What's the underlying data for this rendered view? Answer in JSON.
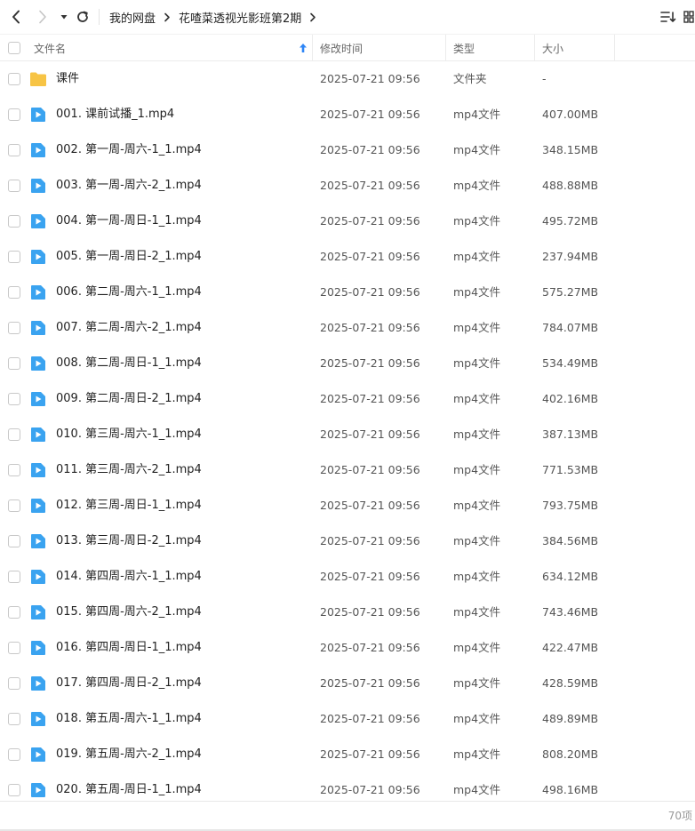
{
  "toolbar": {
    "breadcrumbs": [
      "我的网盘",
      "花喳菜透视光影班第2期"
    ],
    "icons": {
      "back": "back-arrow-icon",
      "forward": "forward-arrow-icon",
      "history": "history-dropdown-icon",
      "refresh": "refresh-icon",
      "sort": "sort-icon",
      "view": "view-toggle-icon"
    }
  },
  "header": {
    "name": "文件名",
    "mtime": "修改时间",
    "type": "类型",
    "size": "大小"
  },
  "colors": {
    "folder": "#f7c445",
    "video": "#3aa3f0",
    "sort_arrow": "#2f86f6"
  },
  "rows": [
    {
      "name": "课件",
      "mtime": "2025-07-21 09:56",
      "type": "文件夹",
      "size": "-",
      "icon": "folder"
    },
    {
      "name": "001. 课前试播_1.mp4",
      "mtime": "2025-07-21 09:56",
      "type": "mp4文件",
      "size": "407.00MB",
      "icon": "video"
    },
    {
      "name": "002. 第一周-周六-1_1.mp4",
      "mtime": "2025-07-21 09:56",
      "type": "mp4文件",
      "size": "348.15MB",
      "icon": "video"
    },
    {
      "name": "003. 第一周-周六-2_1.mp4",
      "mtime": "2025-07-21 09:56",
      "type": "mp4文件",
      "size": "488.88MB",
      "icon": "video"
    },
    {
      "name": "004. 第一周-周日-1_1.mp4",
      "mtime": "2025-07-21 09:56",
      "type": "mp4文件",
      "size": "495.72MB",
      "icon": "video"
    },
    {
      "name": "005. 第一周-周日-2_1.mp4",
      "mtime": "2025-07-21 09:56",
      "type": "mp4文件",
      "size": "237.94MB",
      "icon": "video"
    },
    {
      "name": "006. 第二周-周六-1_1.mp4",
      "mtime": "2025-07-21 09:56",
      "type": "mp4文件",
      "size": "575.27MB",
      "icon": "video"
    },
    {
      "name": "007. 第二周-周六-2_1.mp4",
      "mtime": "2025-07-21 09:56",
      "type": "mp4文件",
      "size": "784.07MB",
      "icon": "video"
    },
    {
      "name": "008. 第二周-周日-1_1.mp4",
      "mtime": "2025-07-21 09:56",
      "type": "mp4文件",
      "size": "534.49MB",
      "icon": "video"
    },
    {
      "name": "009. 第二周-周日-2_1.mp4",
      "mtime": "2025-07-21 09:56",
      "type": "mp4文件",
      "size": "402.16MB",
      "icon": "video"
    },
    {
      "name": "010. 第三周-周六-1_1.mp4",
      "mtime": "2025-07-21 09:56",
      "type": "mp4文件",
      "size": "387.13MB",
      "icon": "video"
    },
    {
      "name": "011. 第三周-周六-2_1.mp4",
      "mtime": "2025-07-21 09:56",
      "type": "mp4文件",
      "size": "771.53MB",
      "icon": "video"
    },
    {
      "name": "012. 第三周-周日-1_1.mp4",
      "mtime": "2025-07-21 09:56",
      "type": "mp4文件",
      "size": "793.75MB",
      "icon": "video"
    },
    {
      "name": "013. 第三周-周日-2_1.mp4",
      "mtime": "2025-07-21 09:56",
      "type": "mp4文件",
      "size": "384.56MB",
      "icon": "video"
    },
    {
      "name": "014. 第四周-周六-1_1.mp4",
      "mtime": "2025-07-21 09:56",
      "type": "mp4文件",
      "size": "634.12MB",
      "icon": "video"
    },
    {
      "name": "015. 第四周-周六-2_1.mp4",
      "mtime": "2025-07-21 09:56",
      "type": "mp4文件",
      "size": "743.46MB",
      "icon": "video"
    },
    {
      "name": "016. 第四周-周日-1_1.mp4",
      "mtime": "2025-07-21 09:56",
      "type": "mp4文件",
      "size": "422.47MB",
      "icon": "video"
    },
    {
      "name": "017. 第四周-周日-2_1.mp4",
      "mtime": "2025-07-21 09:56",
      "type": "mp4文件",
      "size": "428.59MB",
      "icon": "video"
    },
    {
      "name": "018. 第五周-周六-1_1.mp4",
      "mtime": "2025-07-21 09:56",
      "type": "mp4文件",
      "size": "489.89MB",
      "icon": "video"
    },
    {
      "name": "019. 第五周-周六-2_1.mp4",
      "mtime": "2025-07-21 09:56",
      "type": "mp4文件",
      "size": "808.20MB",
      "icon": "video"
    },
    {
      "name": "020. 第五周-周日-1_1.mp4",
      "mtime": "2025-07-21 09:56",
      "type": "mp4文件",
      "size": "498.16MB",
      "icon": "video"
    }
  ],
  "footer": {
    "count": "70项"
  }
}
